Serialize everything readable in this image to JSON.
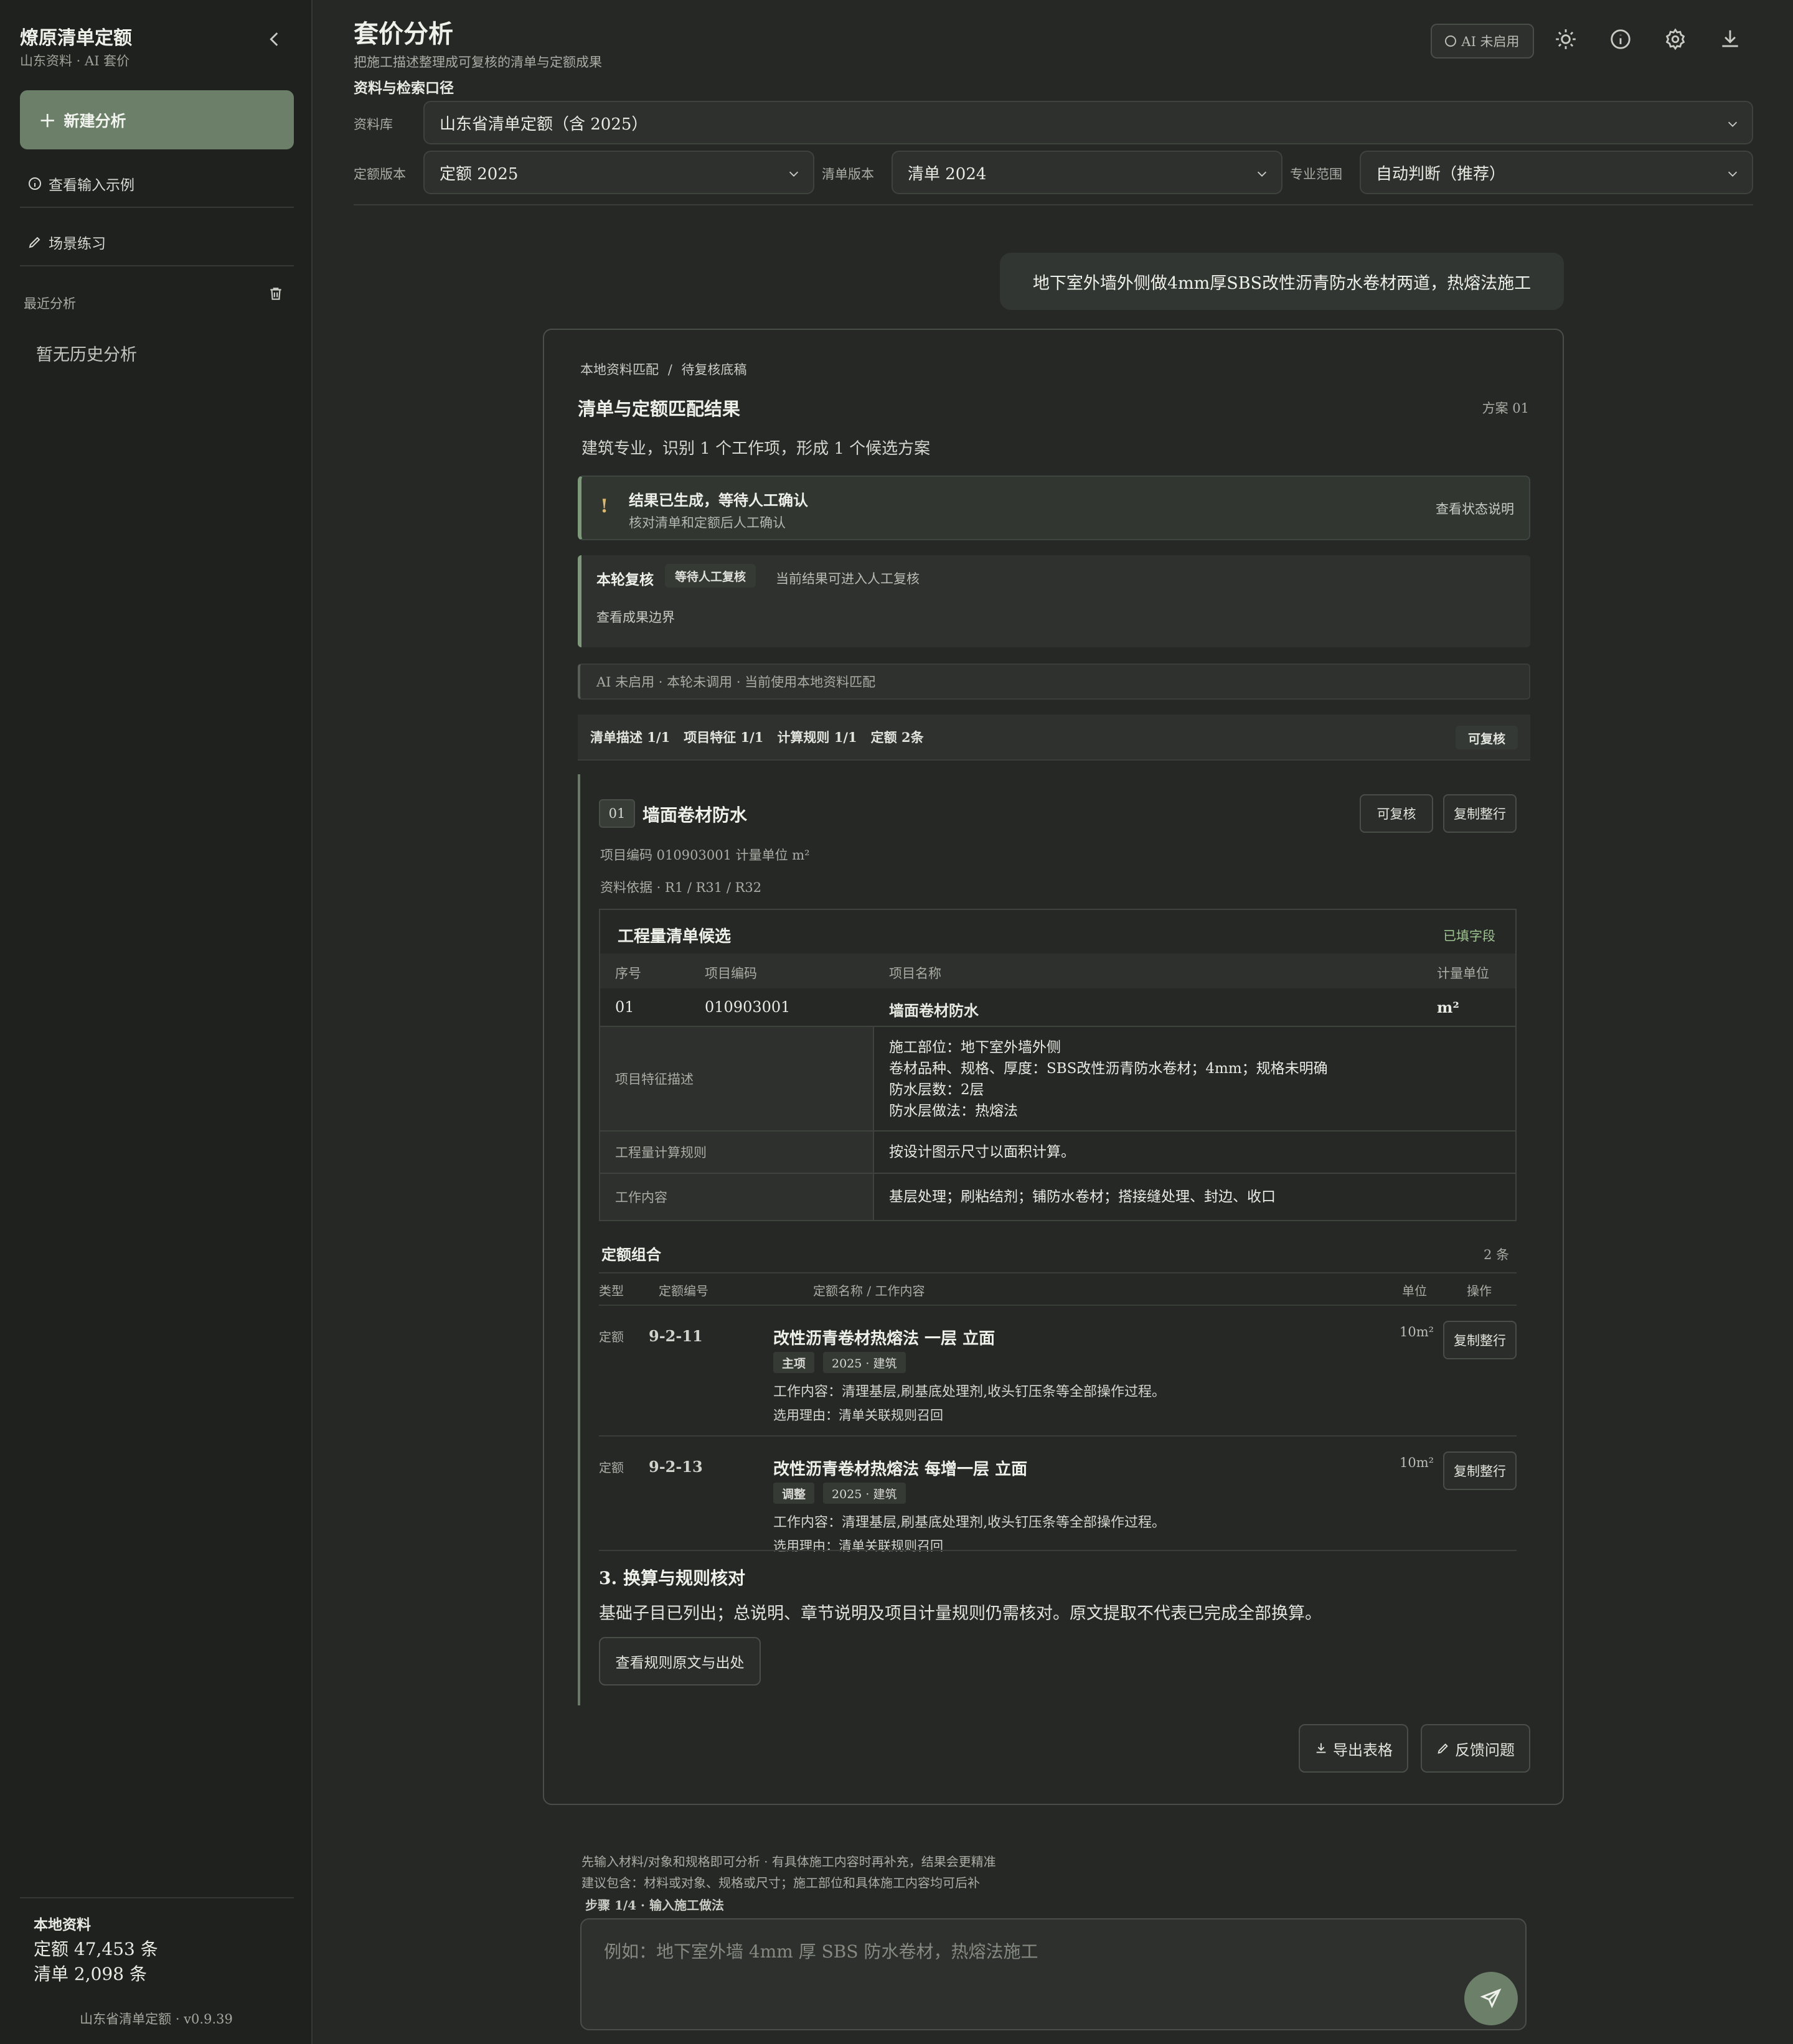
{
  "sidebar": {
    "brand_title": "燎原清单定额",
    "brand_sub": "山东资料 · AI 套价",
    "new_analysis": "新建分析",
    "view_examples": "查看输入示例",
    "scenario_practice": "场景练习",
    "recent_label": "最近分析",
    "empty_history": "暂无历史分析",
    "local_title": "本地资料",
    "quota_count": "定额 47,453 条",
    "bill_count": "清单 2,098 条",
    "version": "山东省清单定额 · v0.9.39"
  },
  "header": {
    "title": "套价分析",
    "subtitle": "把施工描述整理成可复核的清单与定额成果",
    "ai_status": "AI 未启用"
  },
  "filters": {
    "section_label": "资料与检索口径",
    "library_label": "资料库",
    "library_value": "山东省清单定额（含 2025）",
    "quota_version_label": "定额版本",
    "quota_version_value": "定额 2025",
    "bill_version_label": "清单版本",
    "bill_version_value": "清单 2024",
    "scope_label": "专业范围",
    "scope_value": "自动判断（推荐）"
  },
  "user_message": "地下室外墙外侧做4mm厚SBS改性沥青防水卷材两道，热熔法施工",
  "result": {
    "breadcrumb_1": "本地资料匹配",
    "breadcrumb_sep": "/",
    "breadcrumb_2": "待复核底稿",
    "title": "清单与定额匹配结果",
    "plan": "方案 01",
    "summary": "建筑专业，识别 1 个工作项，形成 1 个候选方案",
    "alert_title": "结果已生成，等待人工确认",
    "alert_desc": "核对清单和定额后人工确认",
    "alert_link": "查看状态说明",
    "review_title": "本轮复核",
    "review_tag": "等待人工复核",
    "review_desc": "当前结果可进入人工复核",
    "review_link": "查看成果边界",
    "ai_note": "AI 未启用 · 本轮未调用 · 当前使用本地资料匹配",
    "stats": [
      "清单描述 1/1",
      "项目特征 1/1",
      "计算规则 1/1",
      "定额 2条"
    ],
    "stats_badge": "可复核",
    "export": "导出表格",
    "feedback": "反馈问题"
  },
  "item": {
    "no": "01",
    "name": "墙面卷材防水",
    "reviewable_btn": "可复核",
    "copy_btn": "复制整行",
    "code_meta": "项目编码 010903001   计量单位 m²",
    "basis_meta": "资料依据 · R1 / R31 / R32",
    "bill_table": {
      "title": "工程量清单候选",
      "filled": "已填字段",
      "headers": [
        "序号",
        "项目编码",
        "项目名称",
        "计量单位"
      ],
      "row": [
        "01",
        "010903001",
        "墙面卷材防水",
        "m²"
      ],
      "feature_label": "项目特征描述",
      "features": [
        "施工部位：地下室外墙外侧",
        "卷材品种、规格、厚度：SBS改性沥青防水卷材；4mm；规格未明确",
        "防水层数：2层",
        "防水层做法：热熔法"
      ],
      "rule_label": "工程量计算规则",
      "rule_value": "按设计图示尺寸以面积计算。",
      "work_label": "工作内容",
      "work_value": "基层处理；刷粘结剂；铺防水卷材；搭接缝处理、封边、收口"
    },
    "quota": {
      "title": "定额组合",
      "count": "2 条",
      "headers": [
        "类型",
        "定额编号",
        "定额名称 / 工作内容",
        "单位",
        "操作"
      ],
      "rows": [
        {
          "type": "定额",
          "code": "9-2-11",
          "name": "改性沥青卷材热熔法 一层 立面",
          "tags": [
            "主项",
            "2025 · 建筑"
          ],
          "work": "工作内容：清理基层,刷基底处理剂,收头钉压条等全部操作过程。",
          "reason": "选用理由：清单关联规则召回",
          "unit": "10m²",
          "action": "复制整行"
        },
        {
          "type": "定额",
          "code": "9-2-13",
          "name": "改性沥青卷材热熔法 每增一层 立面",
          "tags": [
            "调整",
            "2025 · 建筑"
          ],
          "work": "工作内容：清理基层,刷基底处理剂,收头钉压条等全部操作过程。",
          "reason": "选用理由：清单关联规则召回",
          "unit": "10m²",
          "action": "复制整行"
        }
      ]
    },
    "conversion": {
      "title": "3. 换算与规则核对",
      "text": "基础子目已列出；总说明、章节说明及项目计量规则仍需核对。原文提取不代表已完成全部换算。",
      "button": "查看规则原文与出处"
    }
  },
  "composer": {
    "hint1": "先输入材料/对象和规格即可分析 · 有具体施工内容时再补充，结果会更精准",
    "hint2": "建议包含：材料或对象、规格或尺寸；施工部位和具体施工内容均可后补",
    "step": "步骤 1/4 · 输入施工做法",
    "placeholder": "例如：地下室外墙 4mm 厚 SBS 防水卷材，热熔法施工"
  }
}
